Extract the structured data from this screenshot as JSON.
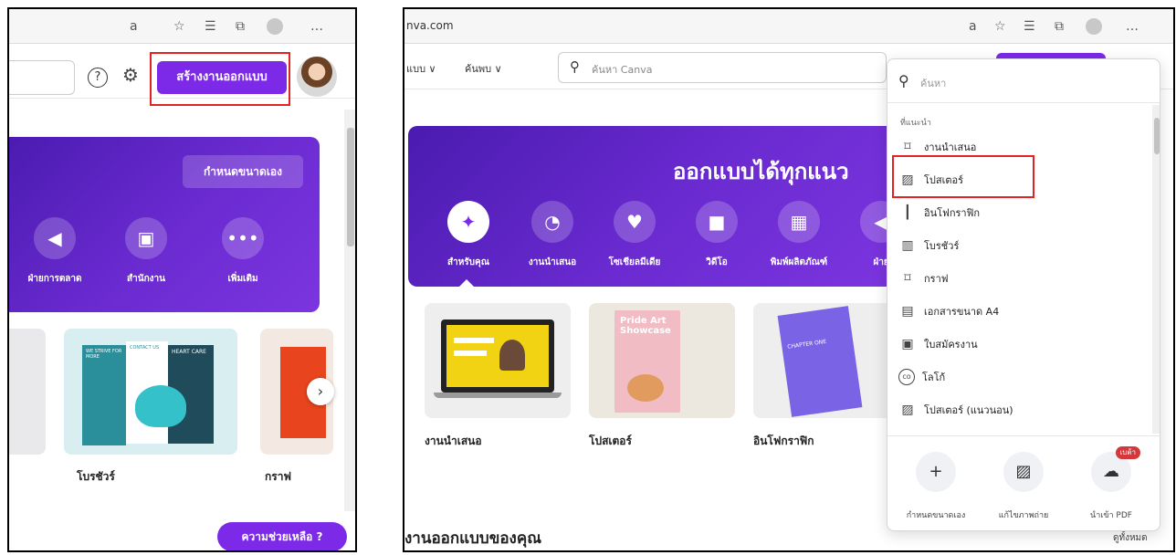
{
  "left": {
    "create_design": "สร้างงานออกแบบ",
    "custom_size": "กำหนดขนาดเอง",
    "categories": [
      "ฝ่ายการตลาด",
      "สำนักงาน",
      "เพิ่มเติม"
    ],
    "thumbs": [
      "โบรชัวร์",
      "กราฟ"
    ],
    "help": "ความช่วยเหลือ ?",
    "brochure_art": {
      "tagline": "WE STRIVE FOR MORE",
      "title": "HEART CARE",
      "contact": "CONTACT US"
    }
  },
  "right": {
    "url": "nva.com",
    "nav": [
      "แบบ ∨",
      "ค้นพบ ∨"
    ],
    "search_placeholder": "ค้นหา Canva",
    "hero_title": "ออกแบบได้ทุกแนว",
    "categories": [
      "สำหรับคุณ",
      "งานนำเสนอ",
      "โซเชียลมีเดีย",
      "วิดีโอ",
      "พิมพ์ผลิตภัณฑ์",
      "ฝ่าย"
    ],
    "thumbs": [
      "งานนำเสนอ",
      "โปสเตอร์",
      "อินโฟกราฟิก"
    ],
    "poster_art": "Pride Art Showcase",
    "booklet_art": "CHAPTER ONE",
    "bottom_title": "งานออกแบบของคุณ",
    "see_all": "ดูทั้งหมด"
  },
  "dropdown": {
    "search_placeholder": "ค้นหา",
    "section": "ที่แนะนำ",
    "items": [
      {
        "icon": "presentation-icon",
        "glyph": "⌑",
        "label": "งานนำเสนอ"
      },
      {
        "icon": "poster-icon",
        "glyph": "▨",
        "label": "โปสเตอร์"
      },
      {
        "icon": "infographic-icon",
        "glyph": "┃",
        "label": "อินโฟกราฟิก"
      },
      {
        "icon": "brochure-icon",
        "glyph": "▥",
        "label": "โบรชัวร์"
      },
      {
        "icon": "graph-icon",
        "glyph": "⌑",
        "label": "กราฟ"
      },
      {
        "icon": "document-icon",
        "glyph": "▤",
        "label": "เอกสารขนาด A4"
      },
      {
        "icon": "resume-icon",
        "glyph": "▣",
        "label": "ใบสมัครงาน"
      },
      {
        "icon": "logo-icon",
        "glyph": "co",
        "label": "โลโก้"
      },
      {
        "icon": "poster-landscape-icon",
        "glyph": "▨",
        "label": "โปสเตอร์ (แนวนอน)"
      }
    ],
    "actions": [
      {
        "icon": "plus-icon",
        "glyph": "+",
        "label": "กำหนดขนาดเอง"
      },
      {
        "icon": "edit-photo-icon",
        "glyph": "▨",
        "label": "แก้ไขภาพถ่าย"
      },
      {
        "icon": "upload-cloud-icon",
        "glyph": "☁",
        "label": "นำเข้า PDF",
        "badge": "เบต้า"
      }
    ]
  },
  "colors": {
    "brand_purple": "#7d2ae8",
    "highlight_red": "#e32222",
    "hero_purple": "#5a22c4"
  }
}
